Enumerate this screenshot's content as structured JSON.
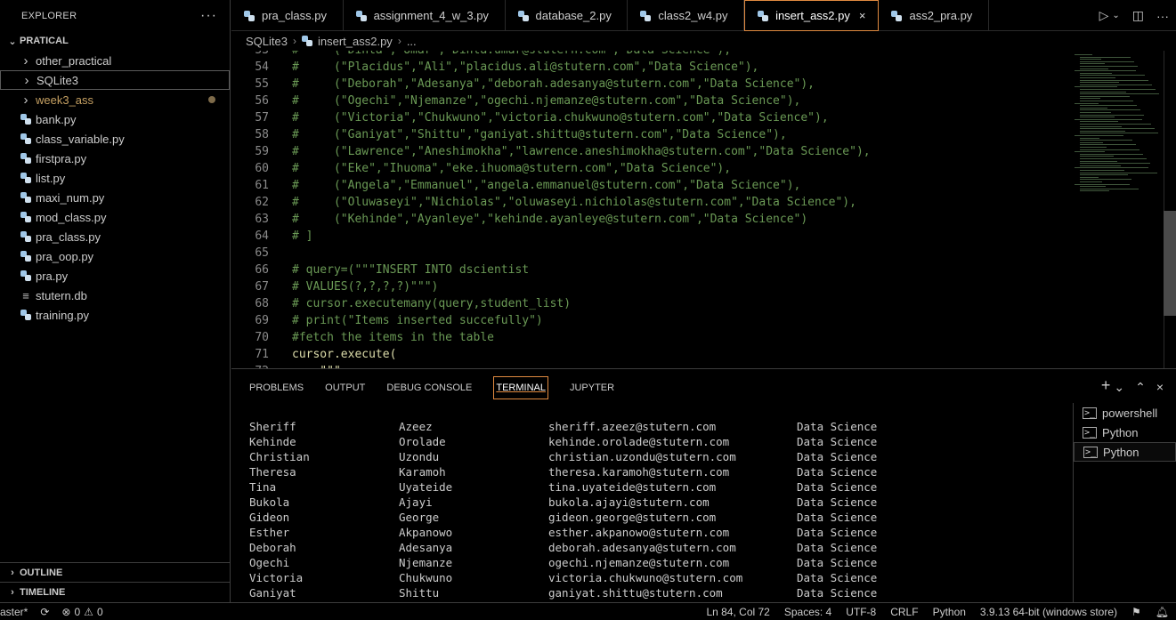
{
  "explorer": {
    "title": "EXPLORER",
    "more": "···",
    "root": "PRATICAL",
    "items": [
      {
        "label": "other_practical",
        "kind": "folder"
      },
      {
        "label": "SQLite3",
        "kind": "folder",
        "selected": true
      },
      {
        "label": "week3_ass",
        "kind": "folder",
        "modified": true
      },
      {
        "label": "bank.py",
        "kind": "py"
      },
      {
        "label": "class_variable.py",
        "kind": "py"
      },
      {
        "label": "firstpra.py",
        "kind": "py"
      },
      {
        "label": "list.py",
        "kind": "py"
      },
      {
        "label": "maxi_num.py",
        "kind": "py"
      },
      {
        "label": "mod_class.py",
        "kind": "py"
      },
      {
        "label": "pra_class.py",
        "kind": "py"
      },
      {
        "label": "pra_oop.py",
        "kind": "py"
      },
      {
        "label": "pra.py",
        "kind": "py"
      },
      {
        "label": "stutern.db",
        "kind": "db"
      },
      {
        "label": "training.py",
        "kind": "py"
      }
    ],
    "outline": "OUTLINE",
    "timeline": "TIMELINE"
  },
  "tabs": [
    {
      "label": "pra_class.py"
    },
    {
      "label": "assignment_4_w_3.py"
    },
    {
      "label": "database_2.py"
    },
    {
      "label": "class2_w4.py"
    },
    {
      "label": "insert_ass2.py",
      "active": true
    },
    {
      "label": "ass2_pra.py"
    }
  ],
  "tab_close": "×",
  "breadcrumb": {
    "folder": "SQLite3",
    "file": "insert_ass2.py",
    "tail": "..."
  },
  "editor": {
    "lines": [
      {
        "n": "53",
        "t": "#     (\"Dinta\",\"Umar\",\"Dinta.umar@stutern.com\",\"Data Science\"),"
      },
      {
        "n": "54",
        "t": "#     (\"Placidus\",\"Ali\",\"placidus.ali@stutern.com\",\"Data Science\"),"
      },
      {
        "n": "55",
        "t": "#     (\"Deborah\",\"Adesanya\",\"deborah.adesanya@stutern.com\",\"Data Science\"),"
      },
      {
        "n": "56",
        "t": "#     (\"Ogechi\",\"Njemanze\",\"ogechi.njemanze@stutern.com\",\"Data Science\"),"
      },
      {
        "n": "57",
        "t": "#     (\"Victoria\",\"Chukwuno\",\"victoria.chukwuno@stutern.com\",\"Data Science\"),"
      },
      {
        "n": "58",
        "t": "#     (\"Ganiyat\",\"Shittu\",\"ganiyat.shittu@stutern.com\",\"Data Science\"),"
      },
      {
        "n": "59",
        "t": "#     (\"Lawrence\",\"Aneshimokha\",\"lawrence.aneshimokha@stutern.com\",\"Data Science\"),"
      },
      {
        "n": "60",
        "t": "#     (\"Eke\",\"Ihuoma\",\"eke.ihuoma@stutern.com\",\"Data Science\"),"
      },
      {
        "n": "61",
        "t": "#     (\"Angela\",\"Emmanuel\",\"angela.emmanuel@stutern.com\",\"Data Science\"),"
      },
      {
        "n": "62",
        "t": "#     (\"Oluwaseyi\",\"Nichiolas\",\"oluwaseyi.nichiolas@stutern.com\",\"Data Science\"),"
      },
      {
        "n": "63",
        "t": "#     (\"Kehinde\",\"Ayanleye\",\"kehinde.ayanleye@stutern.com\",\"Data Science\")"
      },
      {
        "n": "64",
        "t": "# ]"
      },
      {
        "n": "65",
        "t": ""
      },
      {
        "n": "66",
        "t": "# query=(\"\"\"INSERT INTO dscientist"
      },
      {
        "n": "67",
        "t": "# VALUES(?,?,?,?)\"\"\")"
      },
      {
        "n": "68",
        "t": "# cursor.executemany(query,student_list)"
      },
      {
        "n": "69",
        "t": "# print(\"Items inserted succefully\")"
      },
      {
        "n": "70",
        "t": "#fetch the items in the table"
      },
      {
        "n": "71",
        "t": "cursor.execute(",
        "code": true
      },
      {
        "n": "72",
        "t": "    \"\"\"",
        "code": true
      }
    ]
  },
  "panel": {
    "tabs": [
      "PROBLEMS",
      "OUTPUT",
      "DEBUG CONSOLE",
      "TERMINAL",
      "JUPYTER"
    ],
    "active": "TERMINAL",
    "actions": [
      "+",
      "⌄",
      "⌃",
      "×"
    ],
    "terminal_rows": [
      [
        "Sheriff",
        "Azeez",
        "sheriff.azeez@stutern.com",
        "Data Science"
      ],
      [
        "Kehinde",
        "Orolade",
        "kehinde.orolade@stutern.com",
        "Data Science"
      ],
      [
        "Christian",
        "Uzondu",
        "christian.uzondu@stutern.com",
        "Data Science"
      ],
      [
        "Theresa",
        "Karamoh",
        "theresa.karamoh@stutern.com",
        "Data Science"
      ],
      [
        "Tina",
        "Uyateide",
        "tina.uyateide@stutern.com",
        "Data Science"
      ],
      [
        "Bukola",
        "Ajayi",
        "bukola.ajayi@stutern.com",
        "Data Science"
      ],
      [
        "Gideon",
        "George",
        "gideon.george@stutern.com",
        "Data Science"
      ],
      [
        "Esther",
        "Akpanowo",
        "esther.akpanowo@stutern.com",
        "Data Science"
      ],
      [
        "Deborah",
        "Adesanya",
        "deborah.adesanya@stutern.com",
        "Data Science"
      ],
      [
        "Ogechi",
        "Njemanze",
        "ogechi.njemanze@stutern.com",
        "Data Science"
      ],
      [
        "Victoria",
        "Chukwuno",
        "victoria.chukwuno@stutern.com",
        "Data Science"
      ],
      [
        "Ganiyat",
        "Shittu",
        "ganiyat.shittu@stutern.com",
        "Data Science"
      ]
    ],
    "terminals": [
      {
        "label": "powershell"
      },
      {
        "label": "Python"
      },
      {
        "label": "Python",
        "selected": true
      }
    ]
  },
  "status": {
    "branch": "aster*",
    "errors": "0",
    "warnings": "0",
    "position": "Ln 84, Col 72",
    "spaces": "Spaces: 4",
    "encoding": "UTF-8",
    "eol": "CRLF",
    "language": "Python",
    "interpreter": "3.9.13 64-bit (windows store)"
  },
  "colors": {
    "accent": "#e08a40",
    "comment": "#6a9955",
    "function": "#dcdcaa",
    "modified": "#c5a062"
  }
}
